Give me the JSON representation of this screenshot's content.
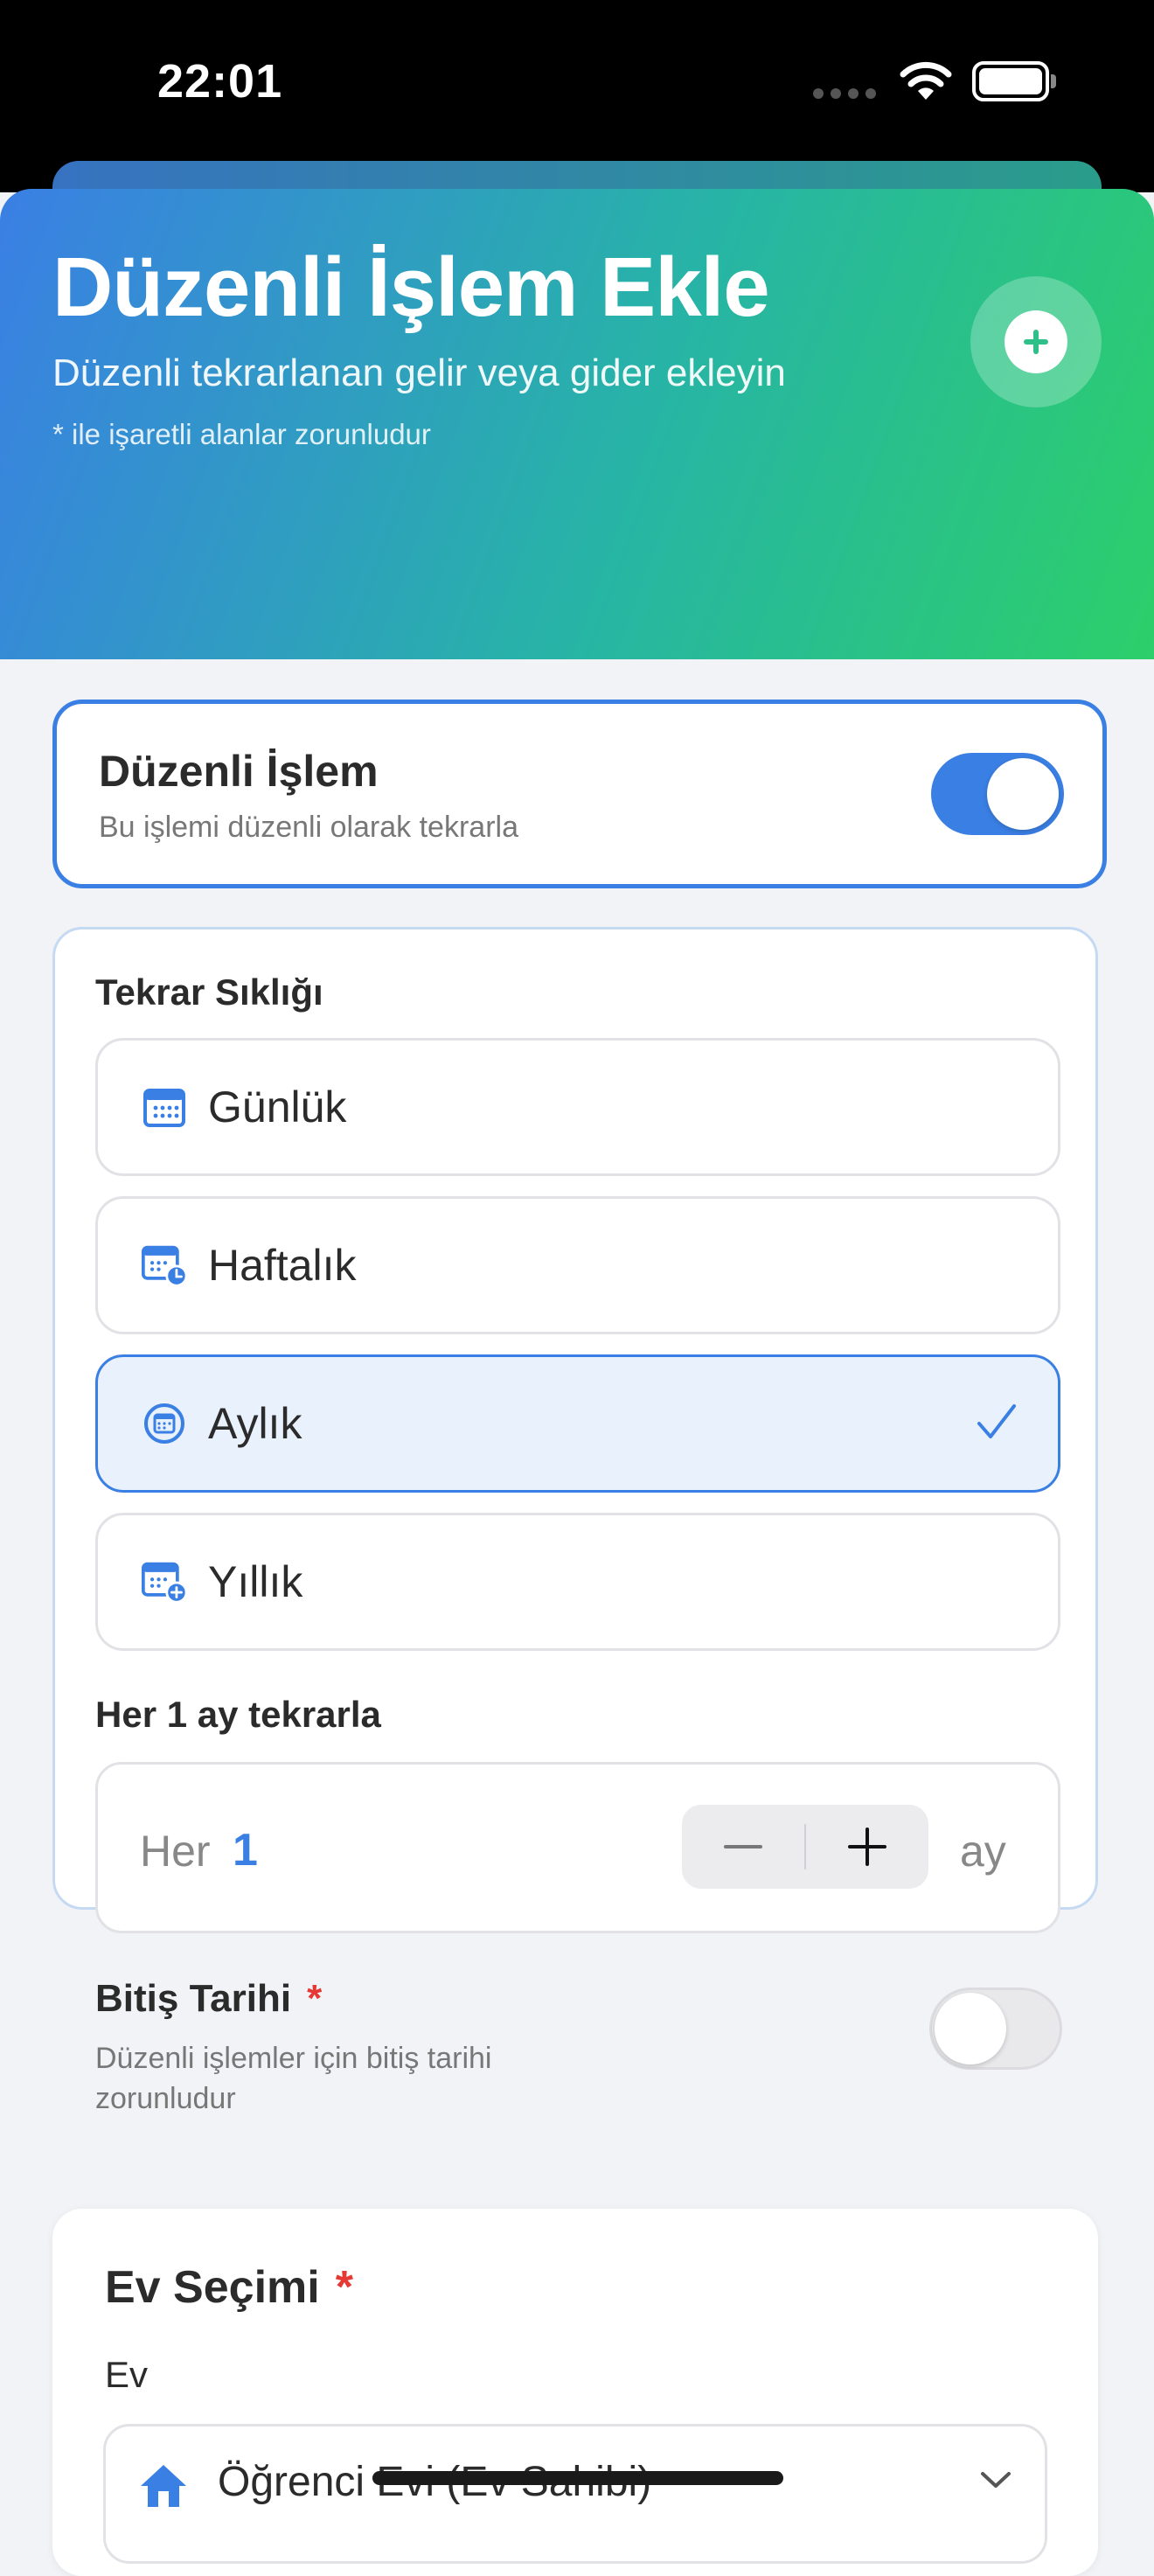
{
  "status_bar": {
    "time": "22:01",
    "icons": [
      "signal-dots-icon",
      "wifi-icon",
      "battery-icon"
    ]
  },
  "header": {
    "title": "Düzenli İşlem Ekle",
    "subtitle": "Düzenli tekrarlanan gelir veya gider ekleyin",
    "note": "* ile işaretli alanlar zorunludur",
    "add_icon": "plus-circle-icon",
    "gradient": [
      "#3a7fe4",
      "#27b4a6",
      "#2ccf6a"
    ]
  },
  "recurring": {
    "title": "Düzenli İşlem",
    "subtitle": "Bu işlemi düzenli olarak tekrarla",
    "enabled": true
  },
  "frequency": {
    "label": "Tekrar Sıklığı",
    "options": [
      {
        "label": "Günlük",
        "icon": "calendar-icon",
        "selected": false
      },
      {
        "label": "Haftalık",
        "icon": "calendar-clock-icon",
        "selected": false
      },
      {
        "label": "Aylık",
        "icon": "calendar-circle-icon",
        "selected": true
      },
      {
        "label": "Yıllık",
        "icon": "calendar-plus-icon",
        "selected": false
      }
    ]
  },
  "interval": {
    "label": "Her 1 ay tekrarla",
    "prefix": "Her",
    "value": "1",
    "unit": "ay",
    "decrement_icon": "minus-icon",
    "increment_icon": "plus-icon"
  },
  "end_date": {
    "title": "Bitiş Tarihi",
    "required_mark": "*",
    "description": "Düzenli işlemler için bitiş tarihi zorunludur",
    "enabled": false
  },
  "house": {
    "title": "Ev Seçimi",
    "required_mark": "*",
    "field_label": "Ev",
    "selected_value": "Öğrenci Evi (Ev Sahibi)",
    "icon": "house-icon",
    "chevron": "chevron-down-icon"
  },
  "colors": {
    "accent": "#3a7fe4",
    "required": "#e53935",
    "selected_bg": "#e9f1fc"
  }
}
